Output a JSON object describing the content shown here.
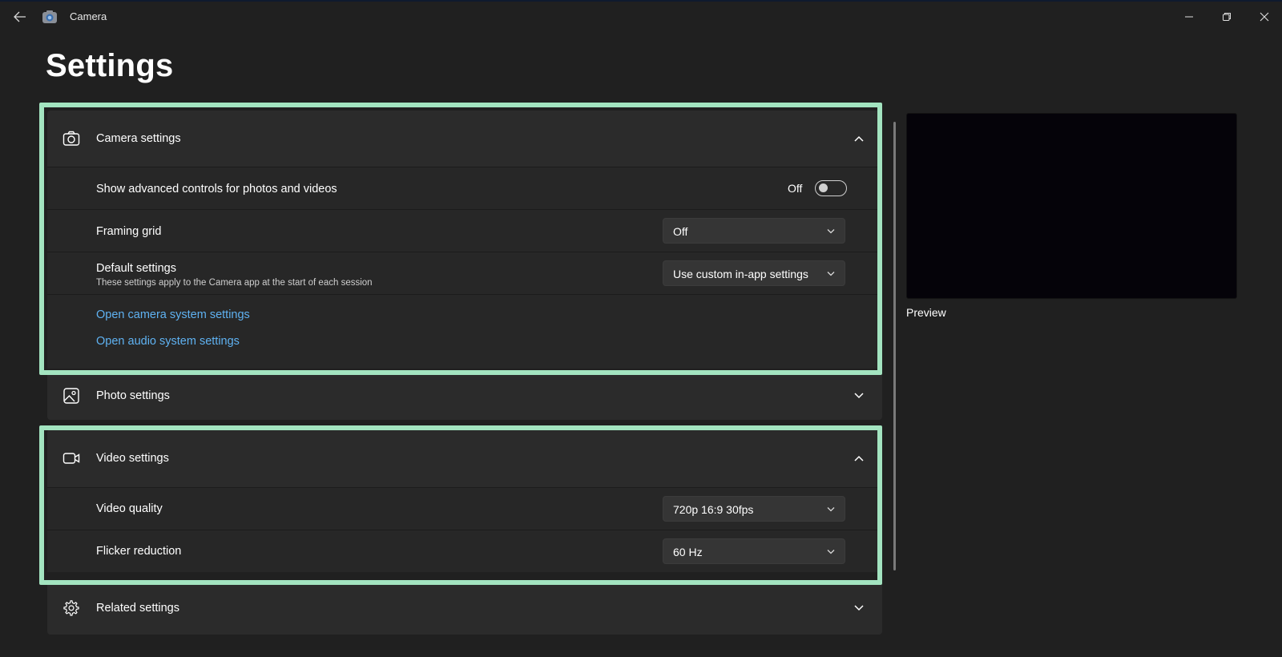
{
  "window": {
    "app_title": "Camera",
    "page_title": "Settings"
  },
  "sections": {
    "camera": {
      "label": "Camera settings",
      "expanded": true,
      "advanced_controls": {
        "label": "Show advanced controls for photos and videos",
        "state_text": "Off",
        "on": false
      },
      "framing_grid": {
        "label": "Framing grid",
        "value": "Off"
      },
      "default_settings": {
        "label": "Default settings",
        "sublabel": "These settings apply to the Camera app at the start of each session",
        "value": "Use custom in-app settings"
      },
      "links": {
        "camera_system": "Open camera system settings",
        "audio_system": "Open audio system settings"
      }
    },
    "photo": {
      "label": "Photo settings",
      "expanded": false
    },
    "video": {
      "label": "Video settings",
      "expanded": true,
      "video_quality": {
        "label": "Video quality",
        "value": "720p 16:9 30fps"
      },
      "flicker_reduction": {
        "label": "Flicker reduction",
        "value": "60 Hz"
      }
    },
    "related": {
      "label": "Related settings",
      "expanded": false
    }
  },
  "preview": {
    "label": "Preview"
  },
  "colors": {
    "background": "#202020",
    "card": "#2b2b2b",
    "highlight": "#a3e4c0",
    "link": "#5fb2f2"
  },
  "icons": [
    "back-arrow-icon",
    "camera-app-icon",
    "minimize-icon",
    "maximize-icon",
    "close-icon",
    "camera-icon",
    "photo-icon",
    "video-icon",
    "gear-icon",
    "chevron-up-icon",
    "chevron-down-icon"
  ]
}
